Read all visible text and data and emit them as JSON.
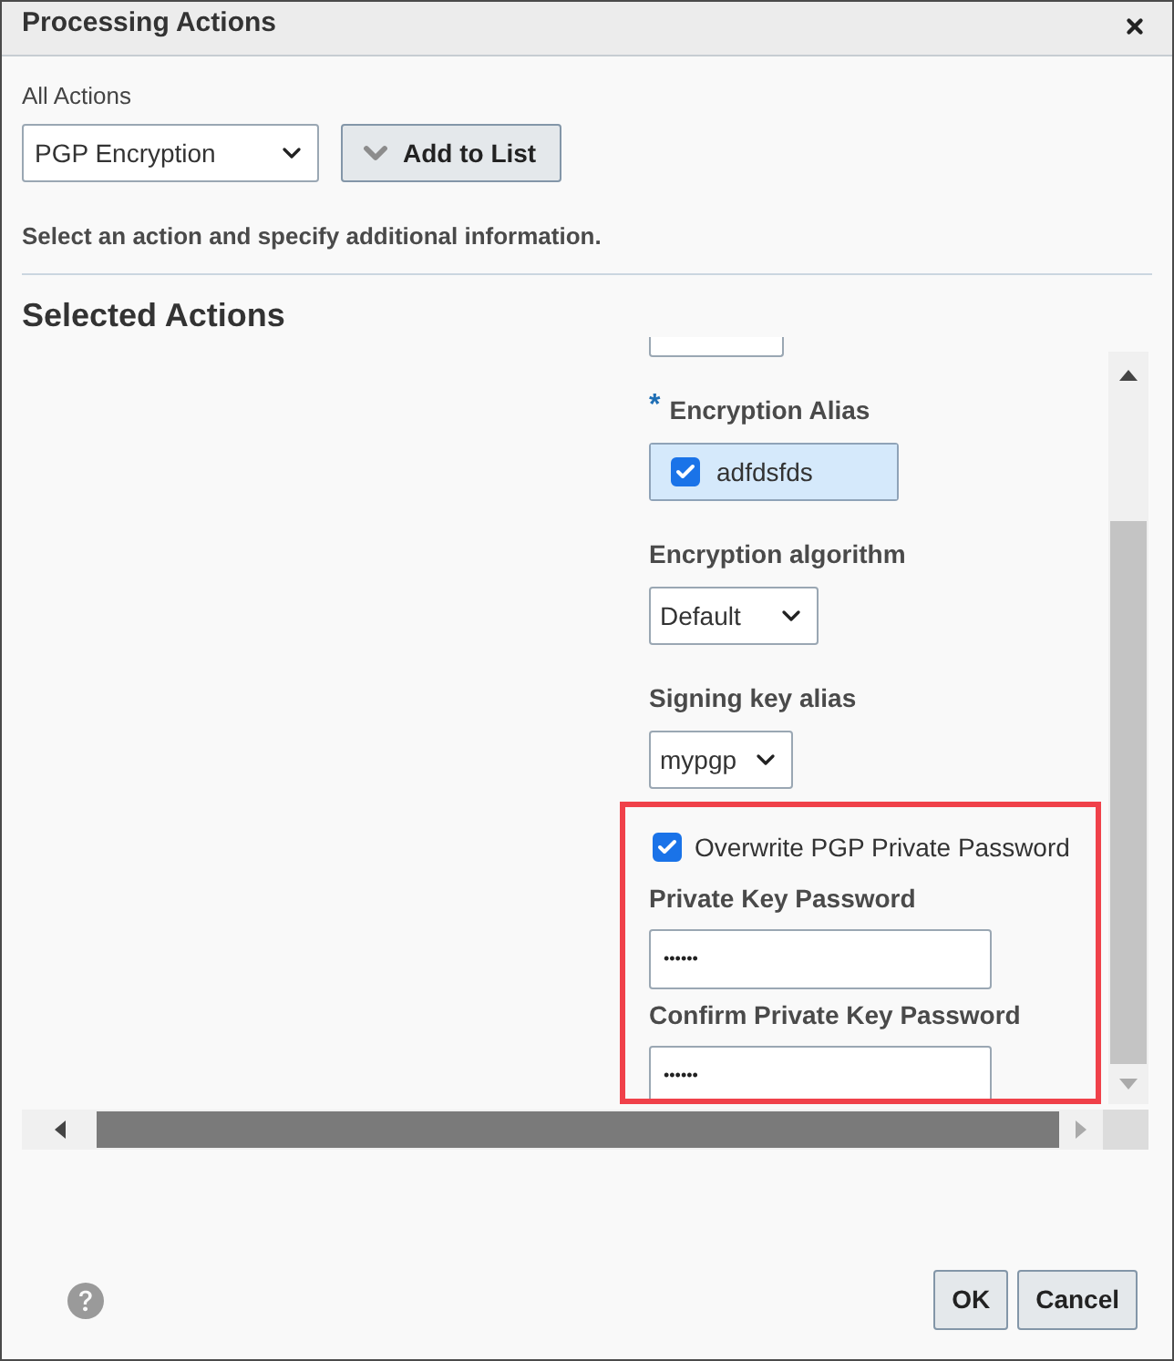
{
  "dialog": {
    "title": "Processing Actions"
  },
  "all_actions": {
    "label": "All Actions",
    "value": "PGP Encryption"
  },
  "add_button": {
    "label": "Add to List"
  },
  "instruction": "Select an action and specify additional information.",
  "selected_actions": {
    "heading": "Selected Actions",
    "fields": [
      {
        "kind": "input"
      },
      {
        "kind": "checklist",
        "label": "Encryption Alias",
        "required_mark": "*",
        "options": [
          {
            "label": "adfdsfds",
            "checked": true,
            "selected": true
          }
        ]
      },
      {
        "kind": "select",
        "label": "Encryption algorithm",
        "value": "Default"
      },
      {
        "kind": "select",
        "label": "Signing key alias",
        "value": "mypgp"
      }
    ],
    "password_section": {
      "highlighted": true,
      "overwrite": {
        "label": "Overwrite PGP Private Password",
        "checked": true
      },
      "fields": [
        {
          "label": "Private Key Password",
          "value": "••••••"
        },
        {
          "label": "Confirm Private Key Password",
          "value": "••••••"
        }
      ]
    }
  },
  "buttons": [
    {
      "label": "OK"
    },
    {
      "label": "Cancel"
    }
  ]
}
